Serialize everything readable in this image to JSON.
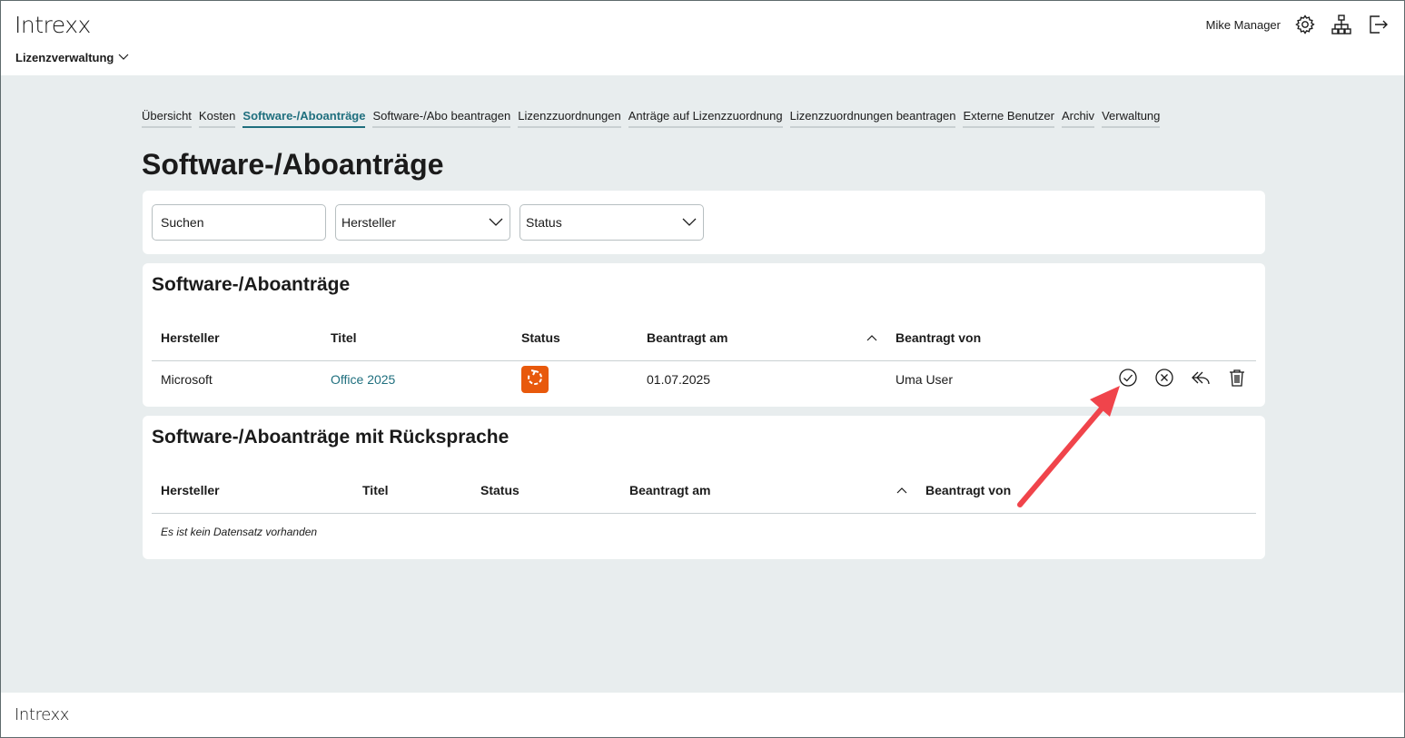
{
  "header": {
    "logo": "Intrexx",
    "app_name": "Lizenzverwaltung",
    "user_name": "Mike Manager"
  },
  "nav": {
    "items": [
      {
        "label": "Übersicht"
      },
      {
        "label": "Kosten"
      },
      {
        "label": "Software-/Aboanträge",
        "active": true
      },
      {
        "label": "Software-/Abo beantragen"
      },
      {
        "label": "Lizenzzuordnungen"
      },
      {
        "label": "Anträge auf Lizenzzuordnung"
      },
      {
        "label": "Lizenzzuordnungen beantragen"
      },
      {
        "label": "Externe Benutzer"
      },
      {
        "label": "Archiv"
      },
      {
        "label": "Verwaltung"
      }
    ]
  },
  "page_title": "Software-/Aboanträge",
  "filters": {
    "search_placeholder": "Suchen",
    "manufacturer_label": "Hersteller",
    "status_label": "Status"
  },
  "requests": {
    "title": "Software-/Aboanträge",
    "columns": {
      "manufacturer": "Hersteller",
      "title": "Titel",
      "status": "Status",
      "requested_at": "Beantragt am",
      "requested_by": "Beantragt von"
    },
    "rows": [
      {
        "manufacturer": "Microsoft",
        "title": "Office 2025",
        "status_icon": "pending-refresh-icon",
        "requested_at": "01.07.2025",
        "requested_by": "Uma User"
      }
    ]
  },
  "consultation": {
    "title": "Software-/Aboanträge mit Rücksprache",
    "columns": {
      "manufacturer": "Hersteller",
      "title": "Titel",
      "status": "Status",
      "requested_at": "Beantragt am",
      "requested_by": "Beantragt von"
    },
    "empty_text": "Es ist kein Datensatz vorhanden"
  },
  "footer": {
    "logo": "Intrexx"
  },
  "colors": {
    "accent": "#1f6f7e",
    "status_badge": "#e8590c",
    "annotation_arrow": "#f0444b",
    "background": "#e8edee"
  }
}
